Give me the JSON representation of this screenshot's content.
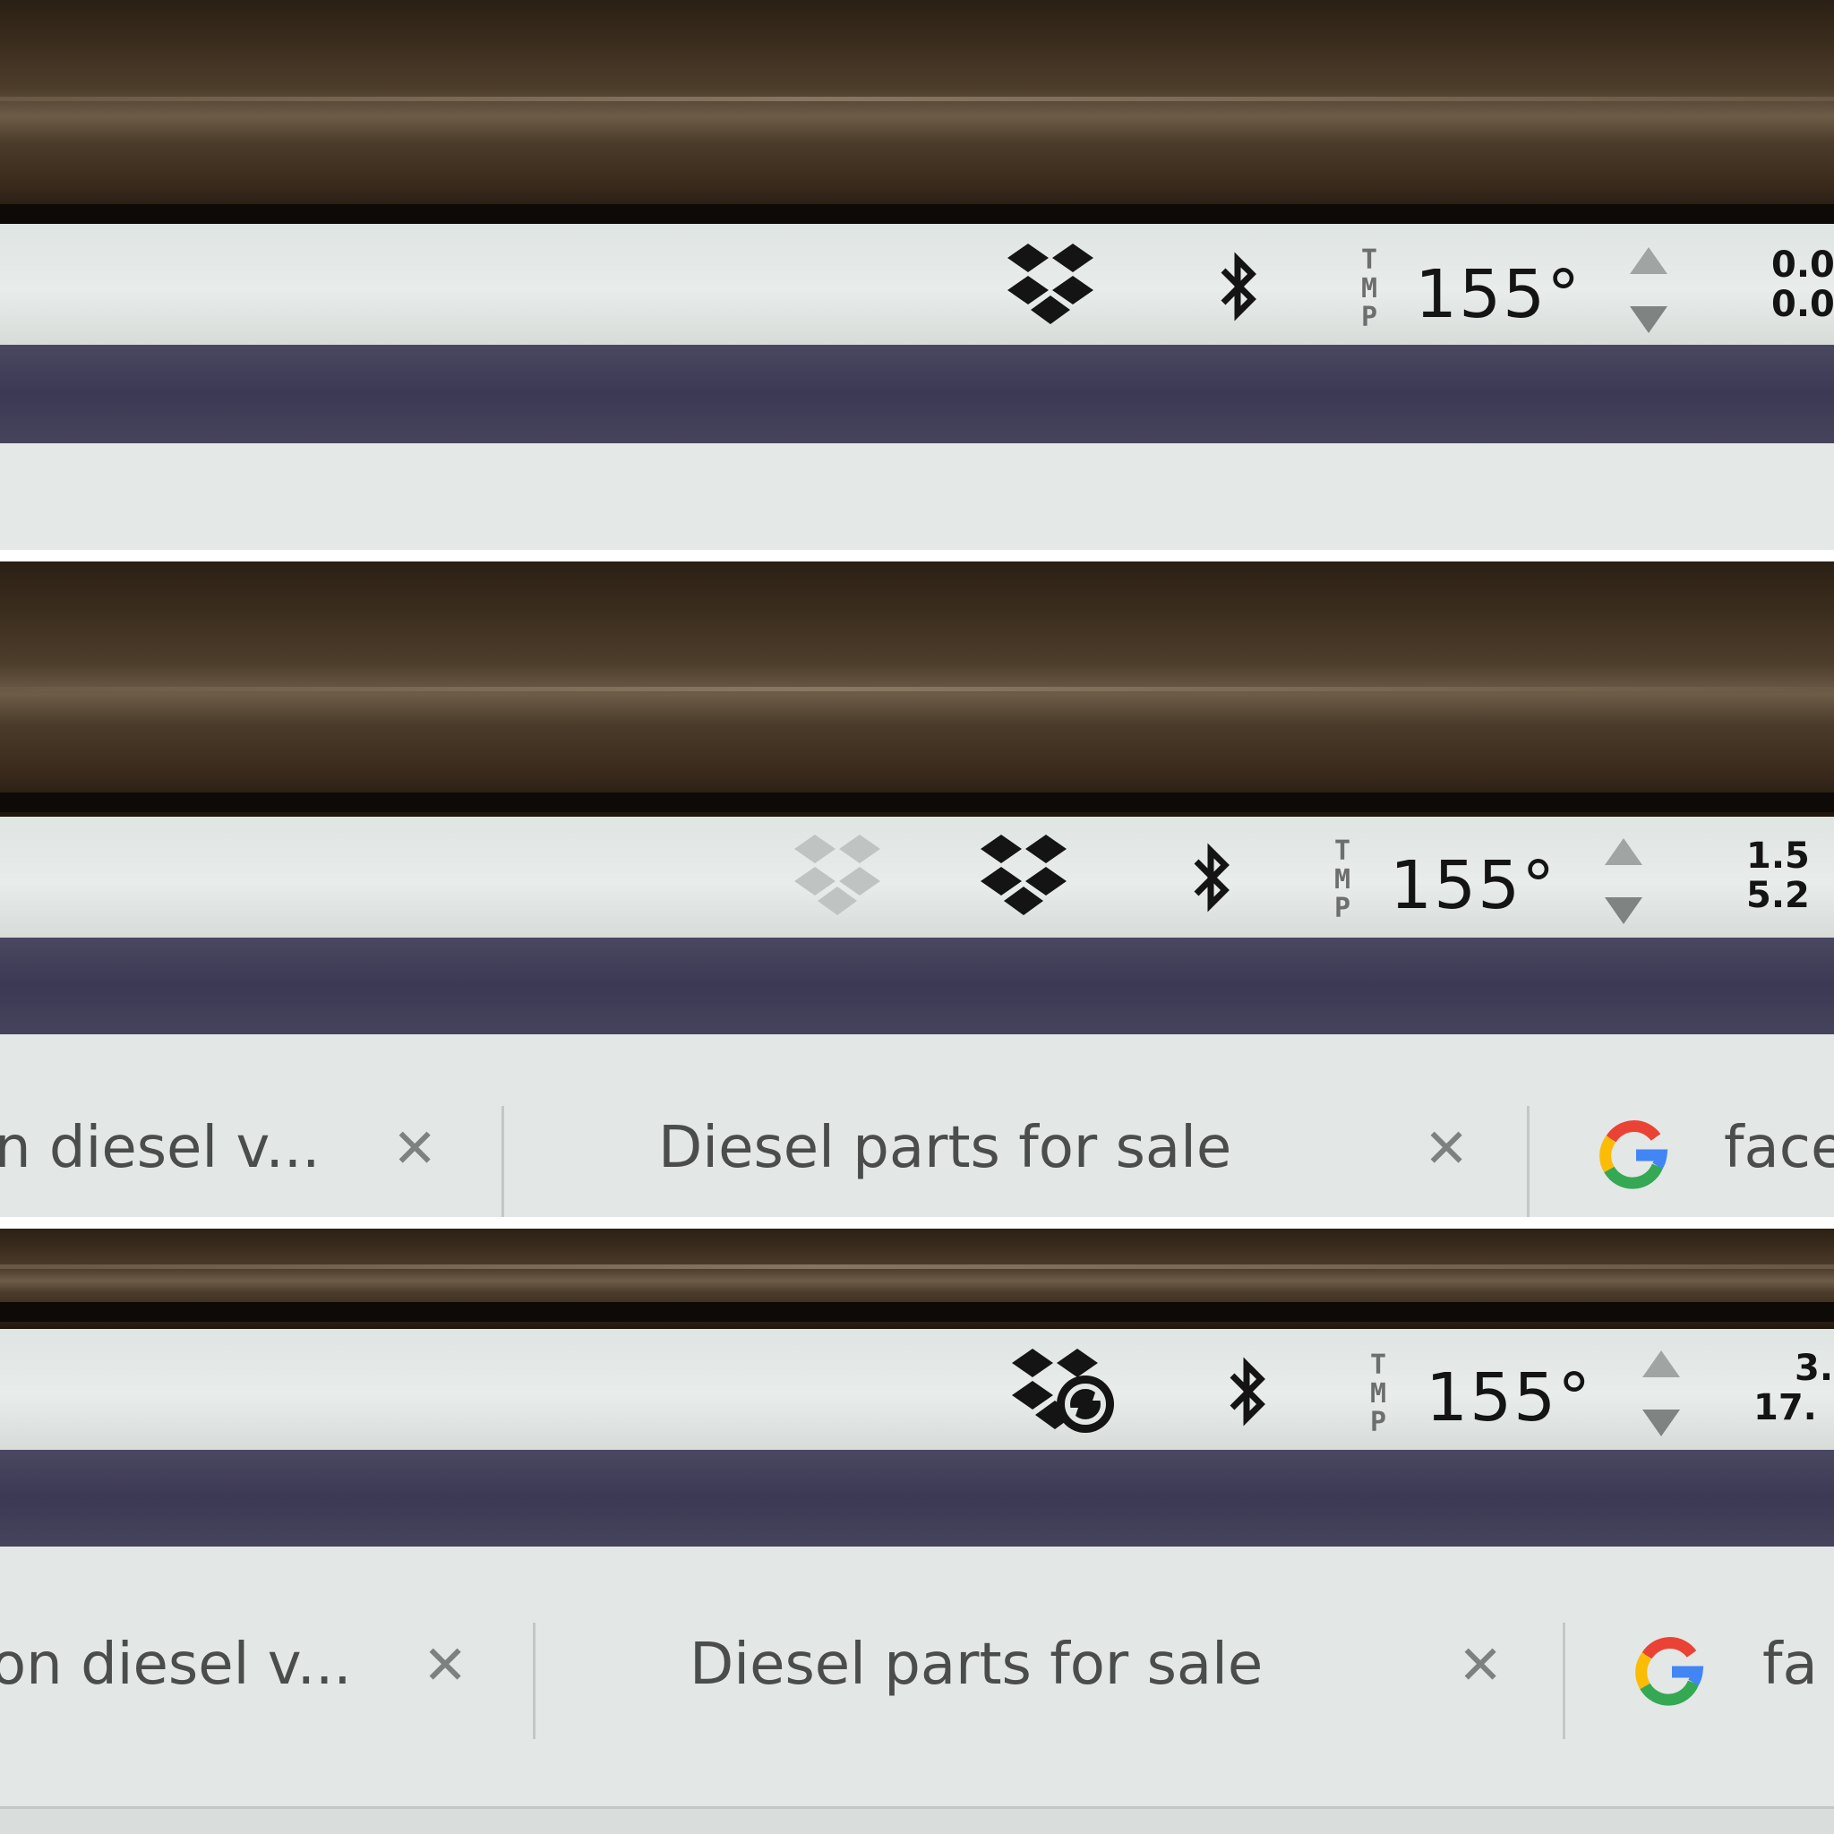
{
  "colors": {
    "menubar": "#e3e8e6",
    "purple_bar": "#3f3c56",
    "icon_black": "#141414",
    "ghost_icon": "#bfc4c2",
    "google_blue": "#4285f4",
    "google_red": "#ea4335",
    "google_yellow": "#fbbc05",
    "google_green": "#34a853"
  },
  "panels": [
    {
      "menubar": {
        "icons": [
          "dropbox-icon",
          "bluetooth-icon",
          "tmp-sensor-icon",
          "up-down-arrows-icon"
        ],
        "temperature": "155°",
        "net_up": "0.0",
        "net_down": "0.0"
      }
    },
    {
      "menubar": {
        "icons": [
          "dropbox-ghost-icon",
          "dropbox-icon",
          "bluetooth-icon",
          "tmp-sensor-icon",
          "up-down-arrows-icon"
        ],
        "temperature": "155°",
        "net_up": "1.5",
        "net_down": "5.2"
      },
      "tabs": [
        {
          "title": "n diesel v...",
          "icon": "close-icon"
        },
        {
          "title": "Diesel parts for sale",
          "icon": "close-icon"
        },
        {
          "title": "face",
          "icon": "google-icon"
        }
      ]
    },
    {
      "menubar": {
        "icons": [
          "dropbox-syncing-icon",
          "bluetooth-icon",
          "tmp-sensor-icon",
          "up-down-arrows-icon"
        ],
        "temperature": "155°",
        "net_up": "3.",
        "net_down": "17."
      },
      "tabs": [
        {
          "title": "on diesel v...",
          "icon": "close-icon"
        },
        {
          "title": "Diesel parts for sale",
          "icon": "close-icon"
        },
        {
          "title": "fa",
          "icon": "google-icon"
        }
      ]
    }
  ],
  "tmp_letters": [
    "T",
    "M",
    "P"
  ],
  "close_glyph": "✕"
}
